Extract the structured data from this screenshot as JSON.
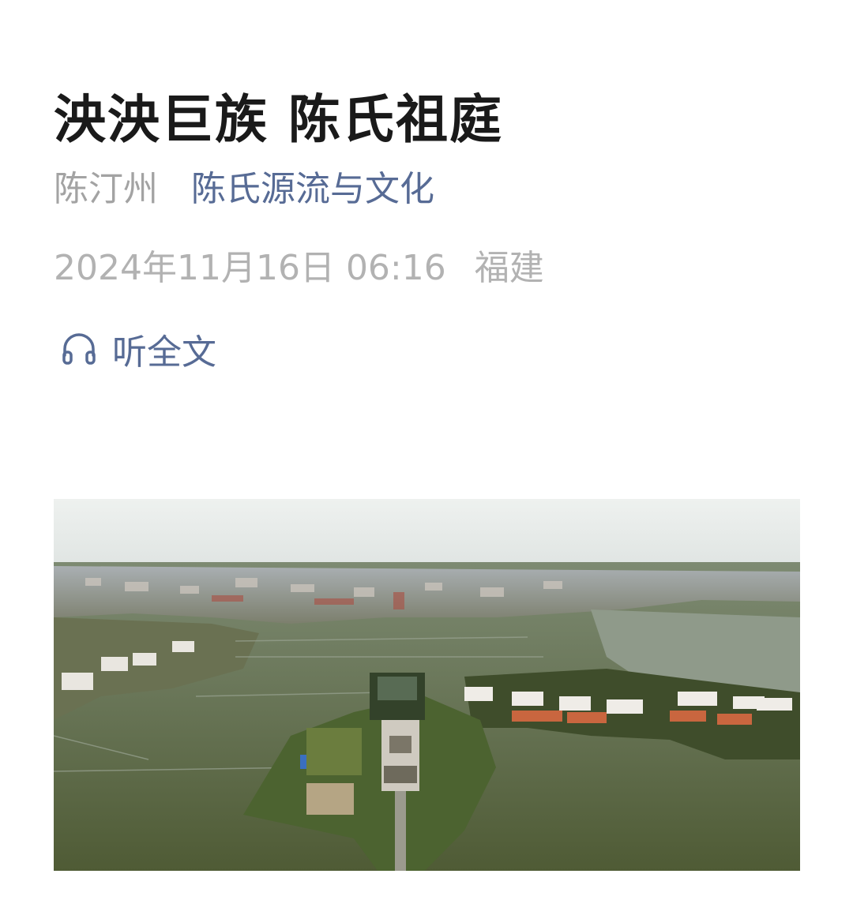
{
  "article": {
    "title": "泱泱巨族 陈氏祖庭",
    "author": "陈汀州",
    "account": "陈氏源流与文化",
    "date": "2024年11月16日 06:16",
    "region": "福建",
    "listen_label": "听全文",
    "listen_icon": "headphone-icon",
    "image_subject": "aerial-photo"
  },
  "colors": {
    "title": "#1a1a1a",
    "author": "#a3a3a3",
    "account": "#576b95",
    "meta": "#b2b2b2",
    "link": "#576b95"
  }
}
